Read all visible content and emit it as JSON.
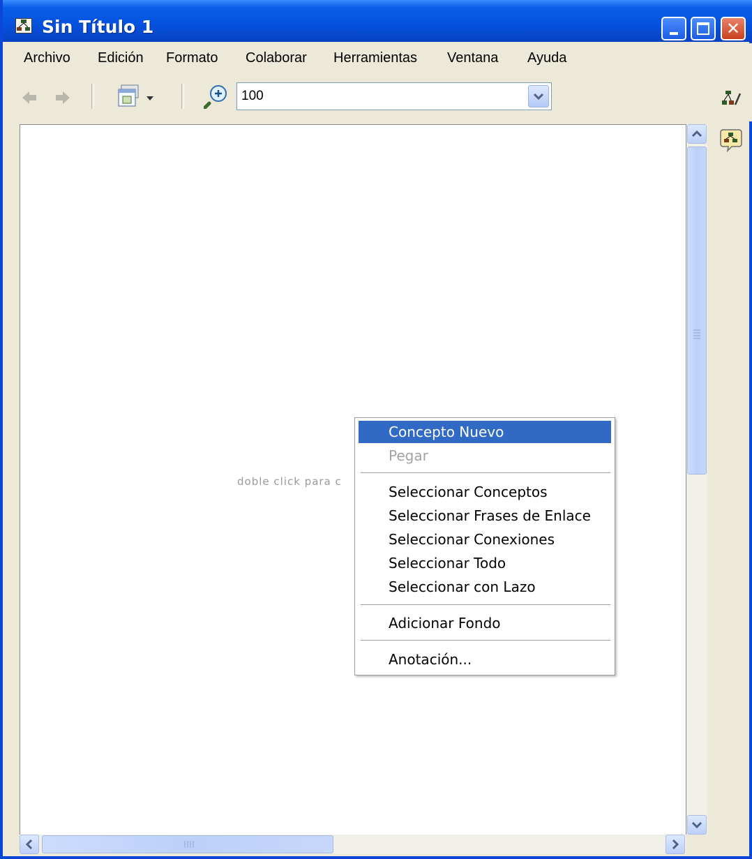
{
  "window": {
    "title": "Sin Título 1"
  },
  "menubar": [
    "Archivo",
    "Edición",
    "Formato",
    "Colaborar",
    "Herramientas",
    "Ventana",
    "Ayuda"
  ],
  "toolbar": {
    "zoom_value": "100"
  },
  "canvas": {
    "hint": "doble click para c"
  },
  "context_menu": {
    "items": [
      "Concepto Nuevo",
      "Pegar",
      "Seleccionar Conceptos",
      "Seleccionar Frases de Enlace",
      "Seleccionar Conexiones",
      "Seleccionar Todo",
      "Seleccionar con Lazo",
      "Adicionar Fondo",
      "Anotación..."
    ],
    "highlighted": "Concepto Nuevo",
    "disabled": "Pegar"
  },
  "colors": {
    "titlebar": "#0553df",
    "highlight": "#316ac5",
    "close": "#c8401d"
  }
}
